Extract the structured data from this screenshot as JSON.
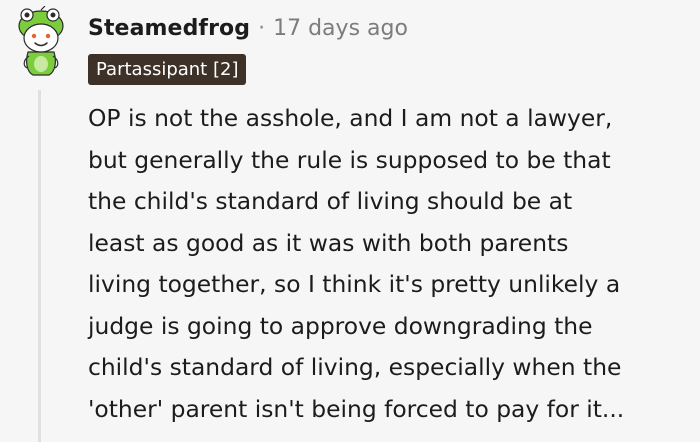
{
  "comment": {
    "username": "Steamedfrog",
    "separator": "·",
    "timestamp": "17 days ago",
    "flair": "Partassipant [2]",
    "body_lines": [
      "OP is not the asshole, and I am not a lawyer,",
      "but generally the rule is supposed to be that",
      "the child's standard of living should be at",
      "least as good as it was with both parents",
      "living together, so I think it's pretty unlikely a",
      "judge is going to approve downgrading the",
      "child's standard of living, especially when the",
      "'other' parent isn't being forced to pay for it..."
    ],
    "avatar_icon": "frog-avatar-icon"
  },
  "colors": {
    "background": "#f6f6f6",
    "text": "#1c1c1c",
    "muted": "#7c7c7c",
    "flair_bg": "#3d3128",
    "avatar_green": "#7ccd3e"
  }
}
